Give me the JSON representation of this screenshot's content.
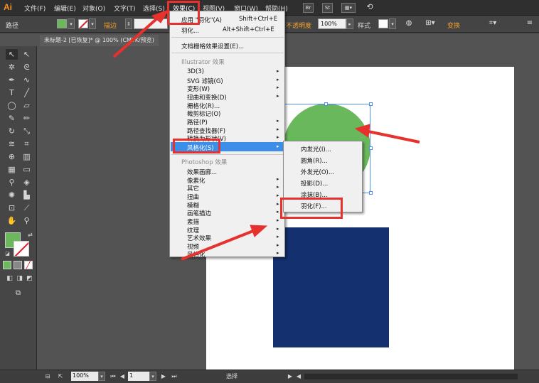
{
  "app": {
    "logo": "Ai"
  },
  "menubar": {
    "items": [
      "文件(F)",
      "编辑(E)",
      "对象(O)",
      "文字(T)",
      "选择(S)",
      "效果(C)",
      "视图(V)",
      "窗口(W)",
      "帮助(H)"
    ],
    "active": "效果(C)",
    "icons": [
      {
        "label": "Br"
      },
      {
        "label": "St"
      }
    ]
  },
  "control_bar": {
    "object_type": "路径",
    "stroke_label": "描边",
    "opacity_label": "不透明度",
    "opacity_value": "100%",
    "style_label": "样式",
    "transform_label": "变换",
    "fill_color": "#6cb85c"
  },
  "document": {
    "tab_title": "未标题-2 [已恢复]* @ 100% (CMYK/预览)",
    "close_icon": "×"
  },
  "effect_menu": {
    "apply_label": "应用 \"羽化\"(A)",
    "apply_shortcut": "Shift+Ctrl+E",
    "feather_label": "羽化...",
    "feather_shortcut": "Alt+Shift+Ctrl+E",
    "raster_settings": "文档栅格效果设置(E)...",
    "illustrator_header": "Illustrator 效果",
    "illustrator_items": [
      "3D(3)",
      "SVG 滤镜(G)",
      "变形(W)",
      "扭曲和变换(D)",
      "栅格化(R)...",
      "裁剪标记(O)",
      "路径(P)",
      "路径查找器(F)",
      "转换为形状(V)",
      "风格化(S)"
    ],
    "photoshop_header": "Photoshop 效果",
    "photoshop_items": [
      "效果画廊...",
      "像素化",
      "其它",
      "扭曲",
      "模糊",
      "画笔描边",
      "素描",
      "纹理",
      "艺术效果",
      "视频",
      "风格化"
    ],
    "highlighted": "风格化(S)"
  },
  "stylize_submenu": {
    "items": [
      "内发光(I)...",
      "圆角(R)...",
      "外发光(O)...",
      "投影(D)...",
      "涂抹(B)...",
      "羽化(F)..."
    ]
  },
  "status_bar": {
    "zoom": "100%",
    "artboard": "1",
    "tool": "选择"
  },
  "colors": {
    "circle": "#6ab85c",
    "rectangle": "#14306e",
    "annotation": "#e6312d",
    "highlight": "#3d8ee8"
  }
}
